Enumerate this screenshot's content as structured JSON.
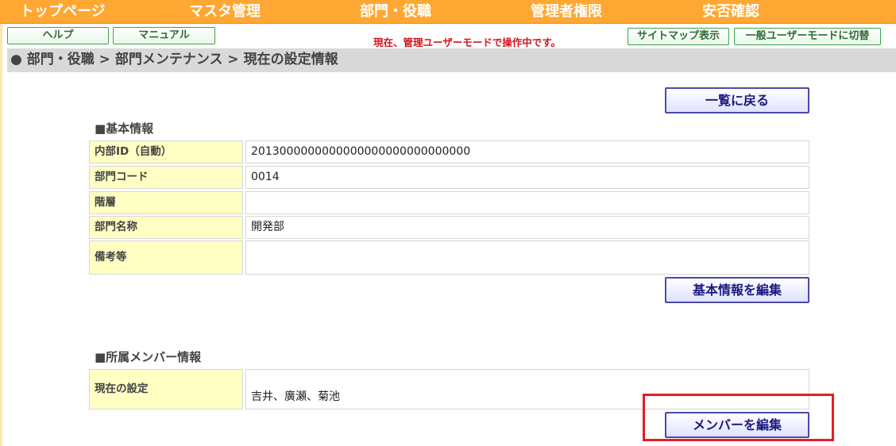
{
  "nav": {
    "items": [
      "トップページ",
      "マスタ管理",
      "部門・役職",
      "管理者権限",
      "安否確認"
    ]
  },
  "toolbar": {
    "help_label": "ヘルプ",
    "manual_label": "マニュアル",
    "mode_message": "現在、管理ユーザーモードで操作中です。",
    "sitemap_label": "サイトマップ表示",
    "switch_mode_label": "一般ユーザーモードに切替"
  },
  "breadcrumb": {
    "bullet": "●",
    "path": "部門・役職 > 部門メンテナンス > 現在の設定情報"
  },
  "actions": {
    "back_label": "一覧に戻る",
    "edit_basic_label": "基本情報を編集",
    "edit_members_label": "メンバーを編集"
  },
  "basic_info": {
    "title": "■基本情報",
    "rows": [
      {
        "label": "内部ID（自動）",
        "value": "2013000000000000000000000000000"
      },
      {
        "label": "部門コード",
        "value": "0014"
      },
      {
        "label": "階層",
        "value": ""
      },
      {
        "label": "部門名称",
        "value": "開発部"
      },
      {
        "label": "備考等",
        "value": ""
      }
    ]
  },
  "members": {
    "title": "■所属メンバー情報",
    "label": "現在の設定",
    "value": "吉井、廣瀬、菊池"
  },
  "colors": {
    "nav_bg": "#ffa733",
    "label_bg": "#ffffc4",
    "highlight": "#e81b23",
    "mode_message": "#d4141b"
  }
}
